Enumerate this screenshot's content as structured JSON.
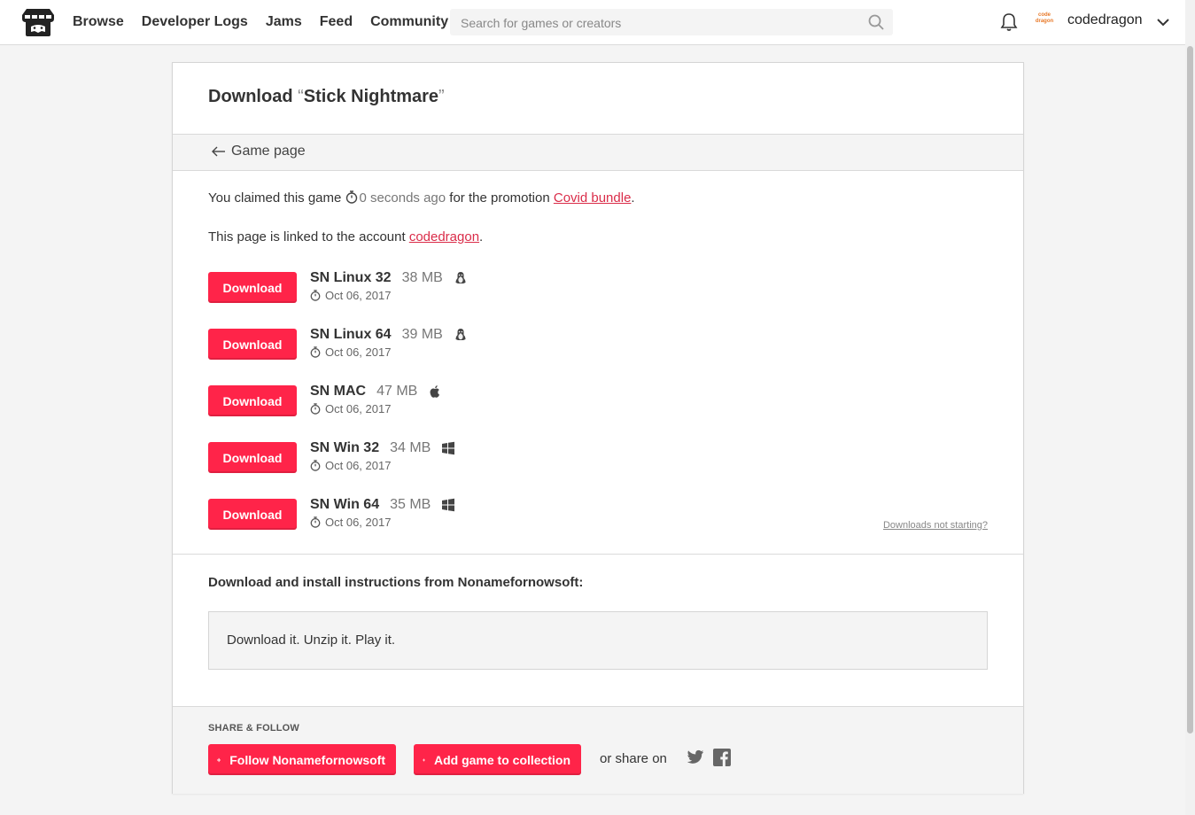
{
  "header": {
    "nav": [
      "Browse",
      "Developer Logs",
      "Jams",
      "Feed",
      "Community"
    ],
    "search_placeholder": "Search for games or creators",
    "avatar_text": "code dragon",
    "username": "codedragon"
  },
  "page": {
    "title_prefix": "Download ",
    "open_quote": "“",
    "game_title": "Stick Nightmare",
    "close_quote": "”",
    "back_label": "Game page",
    "claim_text_1": "You claimed this game ",
    "claim_time": "0 seconds ago",
    "claim_text_2": " for the promotion ",
    "promotion": "Covid bundle",
    "claim_end": ".",
    "linked_text": "This page is linked to the account ",
    "account": "codedragon",
    "linked_end": "."
  },
  "download_label": "Download",
  "uploads": [
    {
      "name": "SN Linux 32",
      "size": "38 MB",
      "os": "linux-icon",
      "date": "Oct 06, 2017"
    },
    {
      "name": "SN Linux 64",
      "size": "39 MB",
      "os": "linux-icon",
      "date": "Oct 06, 2017"
    },
    {
      "name": "SN MAC",
      "size": "47 MB",
      "os": "apple-icon",
      "date": "Oct 06, 2017"
    },
    {
      "name": "SN Win 32",
      "size": "34 MB",
      "os": "windows-icon",
      "date": "Oct 06, 2017"
    },
    {
      "name": "SN Win 64",
      "size": "35 MB",
      "os": "windows-icon",
      "date": "Oct 06, 2017"
    }
  ],
  "downloads_not_starting": "Downloads not starting?",
  "instructions": {
    "title": "Download and install instructions from Nonamefornowsoft:",
    "text": "Download it. Unzip it. Play it."
  },
  "share": {
    "label": "SHARE & FOLLOW",
    "follow_label": "Follow Nonamefornowsoft",
    "collection_label": "Add game to collection",
    "share_on": "or share on"
  },
  "colors": {
    "accent": "#ff2449",
    "link": "#da2c49",
    "background": "#f4f4f4"
  }
}
